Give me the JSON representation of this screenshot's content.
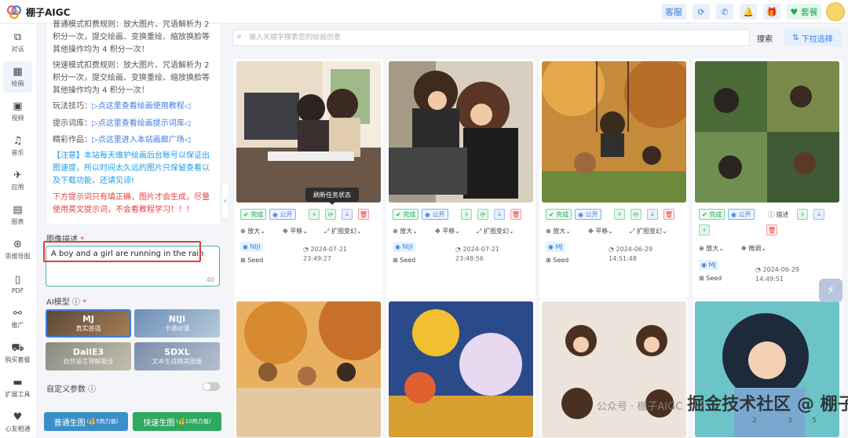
{
  "app": {
    "title": "棚子AIGC"
  },
  "topbar": {
    "service": "客服",
    "plan": "套餐"
  },
  "nav": [
    {
      "label": "对话",
      "icon": "chat-icon"
    },
    {
      "label": "绘画",
      "icon": "paint-icon",
      "active": true
    },
    {
      "label": "视频",
      "icon": "video-icon"
    },
    {
      "label": "音乐",
      "icon": "music-icon"
    },
    {
      "label": "应用",
      "icon": "rocket-icon"
    },
    {
      "label": "图表",
      "icon": "image-icon"
    },
    {
      "label": "思维导图",
      "icon": "mindmap-icon"
    },
    {
      "label": "PDF",
      "icon": "pdf-icon"
    },
    {
      "label": "推广",
      "icon": "share-icon"
    },
    {
      "label": "购买套餐",
      "icon": "cart-icon"
    },
    {
      "label": "扩展工具",
      "icon": "toolbox-icon"
    },
    {
      "label": "心友相通",
      "icon": "heart-icon"
    }
  ],
  "notice": {
    "line1": "普通模式扣费规则：放大图片、咒语解析为 2",
    "line2": "积分一次，提交绘画、变换重绘、缩放换脸等",
    "line3": "其他操作均为 4 积分一次！",
    "line4": "快速模式扣费规则：放大图片、咒语解析为 2",
    "line5": "积分一次，提交绘画、变换重绘、缩放换脸等",
    "line6": "其他操作均为 4 积分一次！",
    "tip_label": "玩法技巧：",
    "tip_link": "▷点这里查看绘画使用教程◁",
    "lib_label": "提示词库：",
    "lib_link": "▷点这里查看绘画提示词库◁",
    "works_label": "精彩作品：",
    "works_link": "▷点这里进入本站画廊广场◁",
    "blue1": "【注意】本站每天维护绘画后台账号以保证出",
    "blue2": "图速度，所以时间太久远的图片只保留查看以",
    "blue3": "及下载功能，还请见谅!",
    "red1": "下方提示词只有填正确，图片才会生成，尽量",
    "red2": "使用英文提示词，不会看教程学习！！！"
  },
  "form": {
    "desc_label": "图像描述",
    "prompt": "A boy and a girl are running in the rain",
    "char_count": "40",
    "model_label": "AI模型",
    "models": [
      {
        "name": "MJ",
        "sub": "真实感强"
      },
      {
        "name": "NIJI",
        "sub": "卡通动漫"
      },
      {
        "name": "DallE3",
        "sub": "自然语言理解最佳"
      },
      {
        "name": "SDXL",
        "sub": "文本生成精美图像"
      }
    ],
    "custom_label": "自定义参数",
    "normal_btn": "普通生图",
    "normal_cost": "(💰5热力值)",
    "fast_btn": "快速生图",
    "fast_cost": "(💰10热力值)"
  },
  "search": {
    "placeholder": "输入关键字搜索您的绘画创意",
    "button": "搜索",
    "dropdown": "下拉选择"
  },
  "tooltip": "刷新任务状态",
  "cards": [
    {
      "done": "完成",
      "public": "公开",
      "zoom": "放大",
      "pan": "平移",
      "expand": "扩图变幻",
      "tag": "NIJI",
      "date": "2024-07-21",
      "time": "23:49:27",
      "seed": "Seed"
    },
    {
      "done": "完成",
      "public": "公开",
      "zoom": "放大",
      "pan": "平移",
      "expand": "扩图变幻",
      "tag": "NIJI",
      "date": "2024-07-21",
      "time": "23:48:56",
      "seed": "Seed"
    },
    {
      "done": "完成",
      "public": "公开",
      "zoom": "放大",
      "pan": "平移",
      "expand": "扩图变幻",
      "tag": "MJ",
      "date": "2024-06-29",
      "time": "14:51:48",
      "seed": "Seed"
    },
    {
      "done": "完成",
      "public": "公开",
      "describe": "描述",
      "zoom": "放大",
      "pan": "微调",
      "tag": "MJ",
      "date": "2024-06-29",
      "time": "14:49:51",
      "seed": "Seed"
    }
  ],
  "pager": [
    "2",
    "3",
    "5"
  ],
  "watermark": {
    "prefix": "公众号 · 棚子AIGC",
    "main": "掘金技术社区 @ 棚子咯"
  }
}
